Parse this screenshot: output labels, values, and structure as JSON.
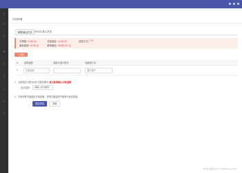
{
  "page": {
    "title": "代付申请"
  },
  "tabs": [
    {
      "label": "单笔添加方式",
      "active": true
    },
    {
      "label": "EXCEL导入方式",
      "active": false
    }
  ],
  "summary": {
    "available_label": "可提取：",
    "available_value": "0.000 元",
    "frozen_label": "冻结资金：",
    "frozen_value": "0.000 元",
    "fee_label": "结算方式：",
    "fee_value": "T+0",
    "per_fee_label": "最低费用：",
    "per_fee_value": "10.00 元",
    "max_label": "单笔最高：",
    "max_value": "50000.00 元"
  },
  "add_button": "+ 添加",
  "table": {
    "headers": [
      "#",
      "结算金额",
      "收款卡银行账号",
      "收款账户名"
    ],
    "rows": [
      {
        "num": "1",
        "amount_placeholder": "付款金额",
        "account_placeholder": "",
        "name_placeholder": "银行账户"
      }
    ]
  },
  "notes": {
    "note1_prefix": "1、当前提交卡数为0张·付款总额为",
    "note1_warn": "请注意请确认付款金额",
    "pay_label": "支付密码：",
    "pay_placeholder": "请输入支付密码",
    "note2": "2、付款总额不能超出可用余额，单笔付款金额不能低于最低费用。"
  },
  "buttons": {
    "submit": "提交申请",
    "reset": "重置"
  },
  "footer": "©2019 金运支付 All Rights Reserved"
}
